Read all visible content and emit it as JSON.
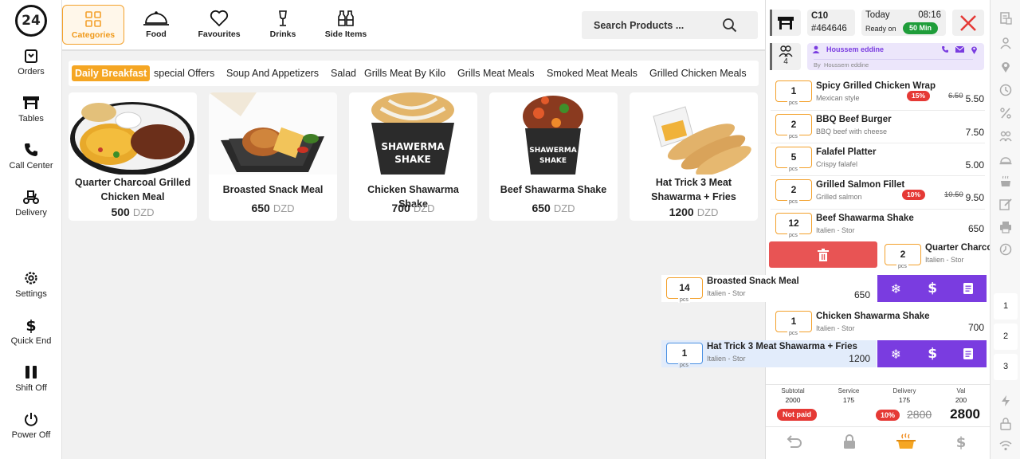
{
  "app": {
    "logo": "24"
  },
  "sidebar": {
    "items": [
      {
        "label": "Orders"
      },
      {
        "label": "Tables"
      },
      {
        "label": "Call Center"
      },
      {
        "label": "Delivery"
      },
      {
        "label": "Settings"
      },
      {
        "label": "Quick End"
      },
      {
        "label": "Shift Off"
      },
      {
        "label": "Power Off"
      }
    ]
  },
  "topbar": {
    "categories": [
      {
        "label": "Categories",
        "icon": "grid-icon",
        "active": true
      },
      {
        "label": "Food",
        "icon": "cloche-icon"
      },
      {
        "label": "Favourites",
        "icon": "heart-icon"
      },
      {
        "label": "Drinks",
        "icon": "drink-icon"
      },
      {
        "label": "Side Items",
        "icon": "bottles-icon"
      }
    ],
    "search_placeholder": "Search Products ..."
  },
  "subcategories": [
    "Daily Breakfast",
    "special Offers",
    "Soup And Appetizers",
    "Salad",
    "Grills Meat By Kilo",
    "Grills Meat Meals",
    "Smoked Meat Meals",
    "Grilled Chicken Meals"
  ],
  "products": [
    {
      "name": "Quarter Charcoal Grilled Chicken Meal",
      "price": "500",
      "currency": "DZD"
    },
    {
      "name": "Broasted Snack Meal",
      "price": "650",
      "currency": "DZD"
    },
    {
      "name": "Chicken Shawarma Shake",
      "price": "700",
      "currency": "DZD"
    },
    {
      "name": "Beef Shawarma Shake",
      "price": "650",
      "currency": "DZD"
    },
    {
      "name": "Hat Trick 3 Meat Shawarma + Fries",
      "price": "1200",
      "currency": "DZD"
    }
  ],
  "order": {
    "table_code": "C10",
    "order_no": "#464646",
    "day": "Today",
    "time": "08:16",
    "ready_label": "Ready on",
    "ready_value": "50 Min",
    "guests": "4",
    "customer": "Houssem eddine",
    "by_label": "By",
    "by_name": "Houssem eddine",
    "qty_unit": "pcs",
    "items": [
      {
        "qty": "1",
        "name": "Spicy Grilled Chicken Wrap",
        "desc": "Mexican style",
        "discount": "15%",
        "old_price": "6.50",
        "price": "5.50"
      },
      {
        "qty": "2",
        "name": "BBQ Beef Burger",
        "desc": "BBQ beef with cheese",
        "price": "7.50"
      },
      {
        "qty": "5",
        "name": "Falafel Platter",
        "desc": "Crispy falafel",
        "price": "5.00"
      },
      {
        "qty": "2",
        "name": "Grilled Salmon Fillet",
        "desc": "Grilled salmon",
        "discount": "10%",
        "old_price": "10.50",
        "price": "9.50"
      },
      {
        "qty": "12",
        "name": "Beef Shawarma Shake",
        "desc": "Italien - Stor",
        "price": "650"
      },
      {
        "qty": "2",
        "name": "Quarter Charcoal Grilled Chicken Meal",
        "desc": "Italien - Stor"
      },
      {
        "qty": "14",
        "name": "Broasted Snack Meal",
        "desc": "Italien - Stor",
        "price": "650"
      },
      {
        "qty": "1",
        "name": "Chicken Shawarma Shake",
        "desc": "Italien - Stor",
        "price": "700"
      },
      {
        "qty": "1",
        "name": "Hat Trick 3 Meat Shawarma + Fries",
        "desc": "Italien - Stor",
        "price": "1200"
      }
    ],
    "totals": [
      {
        "label": "Subtotal",
        "value": "2000"
      },
      {
        "label": "Service",
        "value": "175"
      },
      {
        "label": "Delivery",
        "value": "175"
      },
      {
        "label": "Val",
        "value": "200"
      }
    ],
    "status": "Not paid",
    "total_discount": "10%",
    "total_old": "2800",
    "total": "2800"
  },
  "rail": {
    "pages": [
      "1",
      "2",
      "3"
    ]
  },
  "colors": {
    "accent": "#f5a623",
    "purple": "#7a3ce0",
    "danger": "#e53935",
    "delete": "#e85454",
    "ready": "#1f9d3a"
  }
}
